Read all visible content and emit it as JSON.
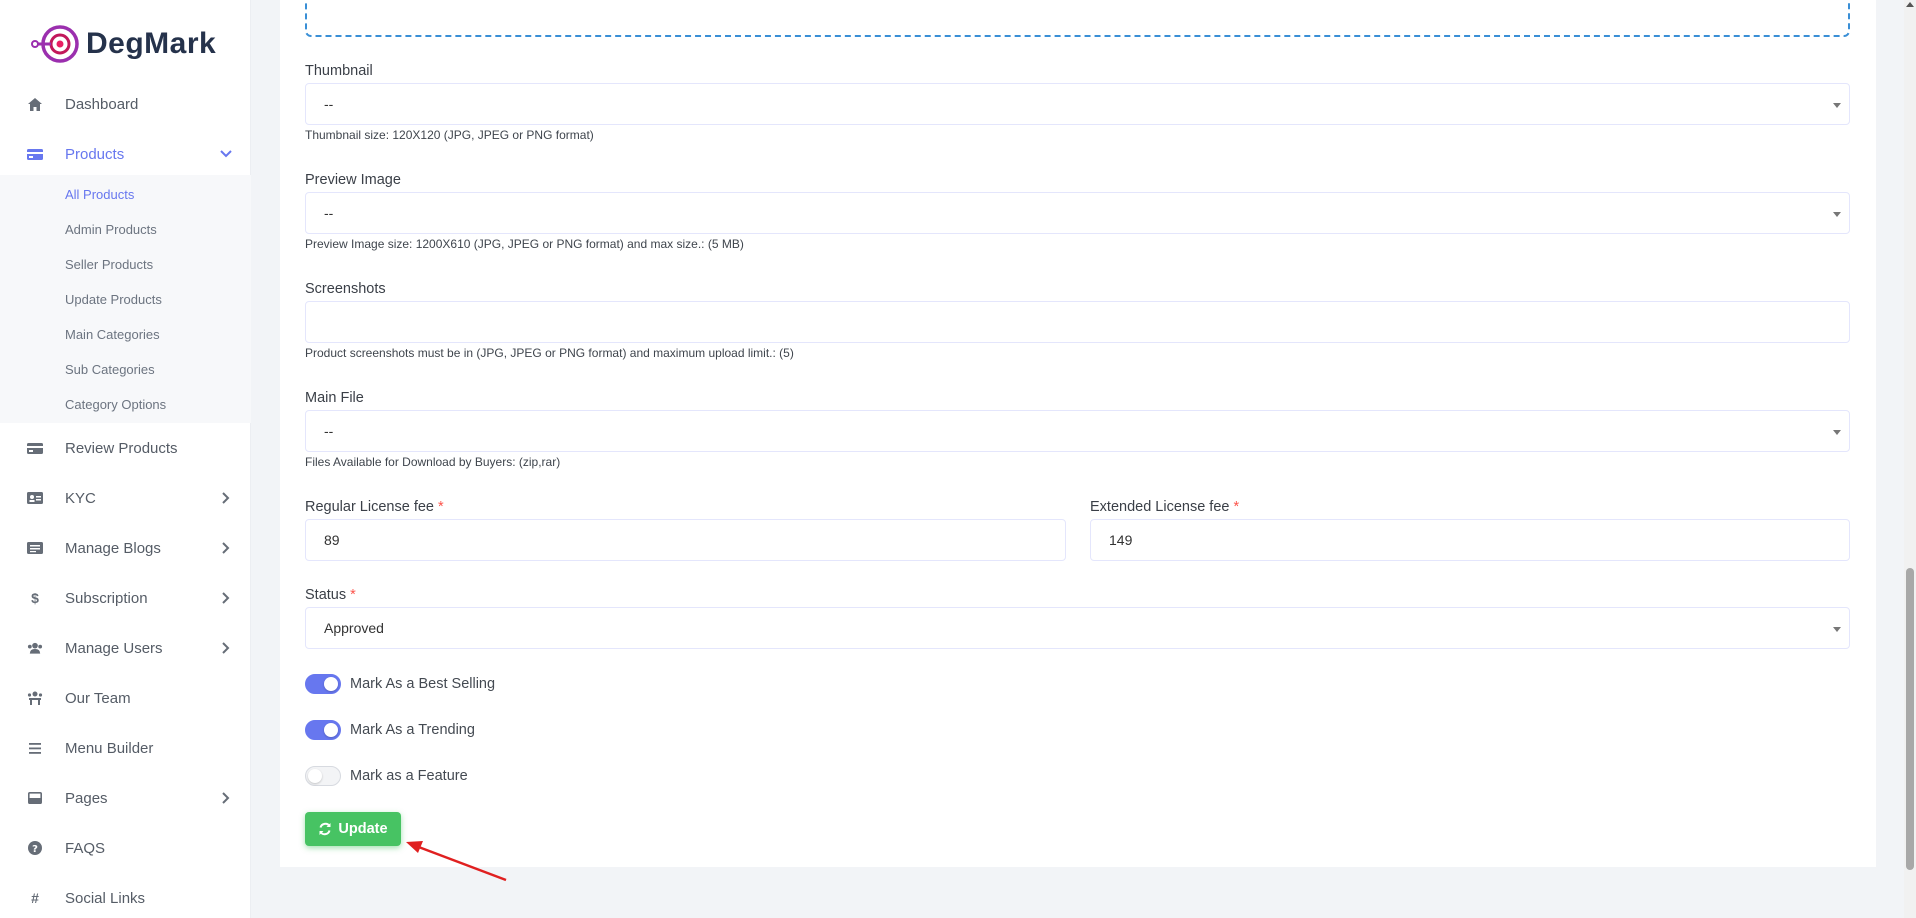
{
  "brand": {
    "name": "DegMark"
  },
  "sidebar": {
    "items": [
      {
        "label": "Dashboard",
        "icon": "home-icon"
      },
      {
        "label": "Products",
        "icon": "card-icon",
        "active": true,
        "expanded": true
      },
      {
        "label": "Review Products",
        "icon": "card-icon"
      },
      {
        "label": "KYC",
        "icon": "id-card-icon"
      },
      {
        "label": "Manage Blogs",
        "icon": "list-icon"
      },
      {
        "label": "Subscription",
        "icon": "dollar-icon"
      },
      {
        "label": "Manage Users",
        "icon": "users-icon"
      },
      {
        "label": "Our Team",
        "icon": "team-icon"
      },
      {
        "label": "Menu Builder",
        "icon": "bars-icon"
      },
      {
        "label": "Pages",
        "icon": "page-icon"
      },
      {
        "label": "FAQS",
        "icon": "question-icon"
      },
      {
        "label": "Social Links",
        "icon": "hash-icon"
      }
    ],
    "products_submenu": [
      "All Products",
      "Admin Products",
      "Seller Products",
      "Update Products",
      "Main Categories",
      "Sub Categories",
      "Category Options"
    ]
  },
  "form": {
    "thumbnail": {
      "label": "Thumbnail",
      "value": "--",
      "hint": "Thumbnail size: 120X120 (JPG, JPEG or PNG format)"
    },
    "preview_image": {
      "label": "Preview Image",
      "value": "--",
      "hint": "Preview Image size: 1200X610 (JPG, JPEG or PNG format) and max size.: (5 MB)"
    },
    "screenshots": {
      "label": "Screenshots",
      "value": "",
      "hint": "Product screenshots must be in (JPG, JPEG or PNG format) and maximum upload limit.: (5)"
    },
    "main_file": {
      "label": "Main File",
      "value": "--",
      "hint": "Files Available for Download by Buyers: (zip,rar)"
    },
    "regular_fee": {
      "label": "Regular License fee",
      "required": "*",
      "value": "89"
    },
    "extended_fee": {
      "label": "Extended License fee",
      "required": "*",
      "value": "149"
    },
    "status": {
      "label": "Status",
      "required": "*",
      "value": "Approved"
    },
    "toggles": [
      {
        "label": "Mark As a Best Selling",
        "on": true
      },
      {
        "label": "Mark As a Trending",
        "on": true
      },
      {
        "label": "Mark as a Feature",
        "on": false
      }
    ],
    "update_button": "Update"
  },
  "colors": {
    "accent": "#6777ef",
    "success": "#47c363",
    "required": "#fc544b",
    "annotation_arrow": "#e02020"
  }
}
